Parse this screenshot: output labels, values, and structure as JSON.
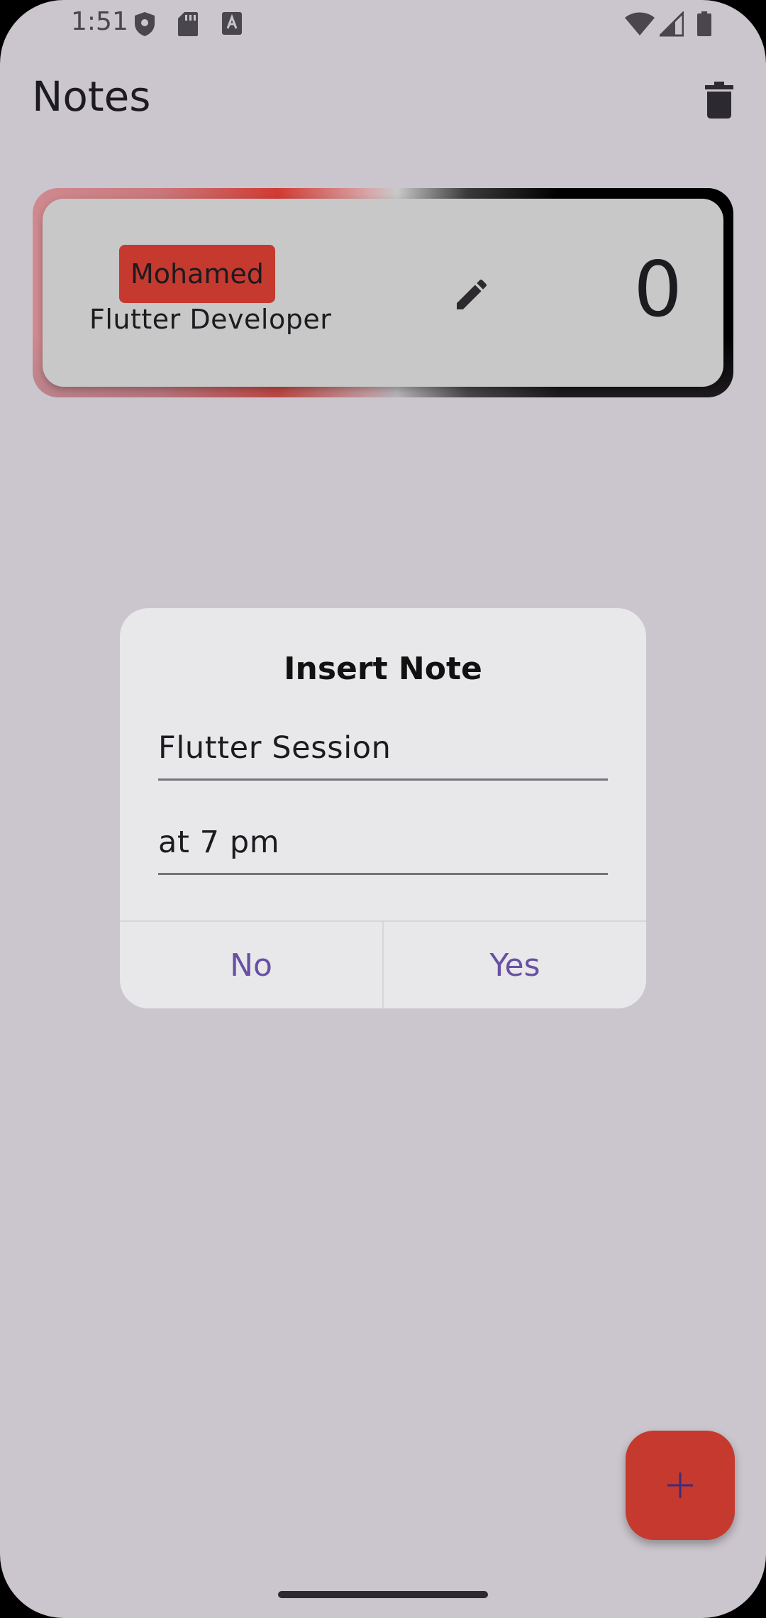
{
  "status_bar": {
    "time": "1:51",
    "left_icons": [
      "shield-icon",
      "sd-card-icon",
      "keyboard-a-icon"
    ],
    "right_icons": [
      "wifi-icon",
      "cell-signal-icon",
      "battery-icon"
    ]
  },
  "app_bar": {
    "title": "Notes",
    "action_icon": "delete-icon"
  },
  "note_card": {
    "name": "Mohamed",
    "role": "Flutter Developer",
    "edit_icon": "pencil-icon",
    "count": "0"
  },
  "dialog": {
    "title": "Insert Note",
    "title_field_value": "Flutter Session",
    "body_field_value": "at 7 pm",
    "no_label": "No",
    "yes_label": "Yes"
  },
  "fab": {
    "icon": "plus-icon"
  },
  "colors": {
    "background": "#cbc6cd",
    "accent_red": "#c5392f",
    "card": "#c8c8c8",
    "dialog": "#e8e7e9",
    "button_text": "#6750a4"
  }
}
